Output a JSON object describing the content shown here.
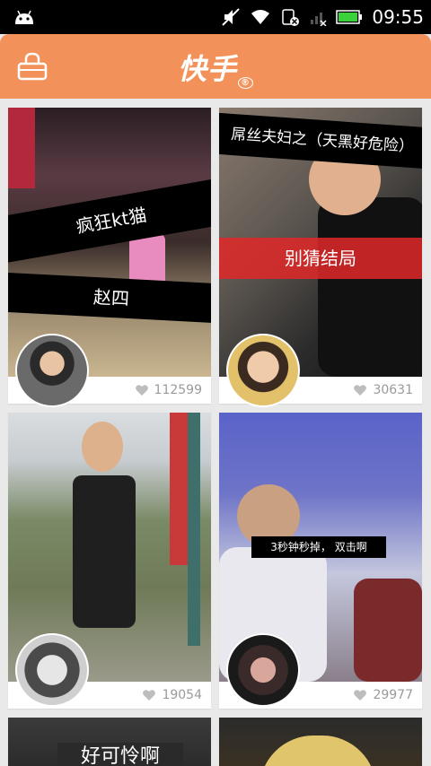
{
  "status_bar": {
    "time": "09:55",
    "icons": [
      "android-icon",
      "mute-icon",
      "wifi-icon",
      "sim-off-icon",
      "signal-icon",
      "battery-icon"
    ]
  },
  "header": {
    "logo_text": "快手",
    "logo_mark": "®",
    "lock_icon": "lock-icon"
  },
  "colors": {
    "brand": "#f2925a",
    "status_bar": "#000000",
    "feed_background": "#e9e9e9",
    "like_text": "#9a9a9a"
  },
  "feed": {
    "cards": [
      {
        "captions": [
          "疯狂kt猫",
          "赵四"
        ],
        "likes": "112599"
      },
      {
        "captions": [
          "屌丝夫妇之（天黑好危险）",
          "别猜结局"
        ],
        "likes": "30631"
      },
      {
        "captions": [],
        "likes": "19054"
      },
      {
        "captions": [
          "3秒钟秒掉， 双击啊"
        ],
        "likes": "29977"
      },
      {
        "captions": [
          "好可怜啊"
        ],
        "likes": ""
      },
      {
        "captions": [],
        "likes": ""
      }
    ]
  }
}
